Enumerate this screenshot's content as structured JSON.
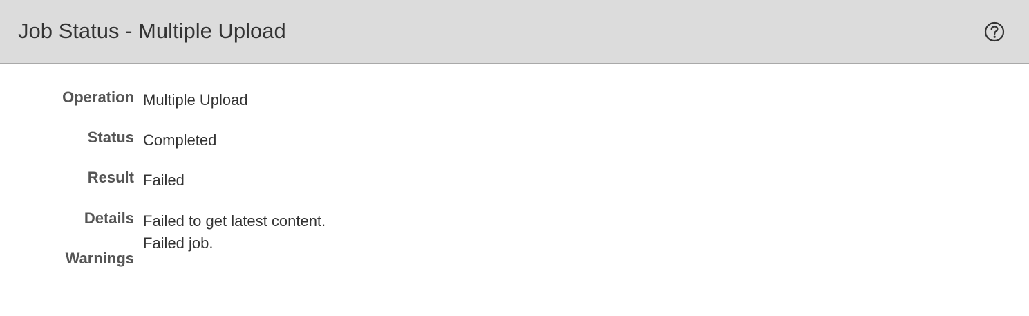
{
  "header": {
    "title": "Job Status - Multiple Upload",
    "help_icon": "help-circle-icon"
  },
  "fields": {
    "operation": {
      "label": "Operation",
      "value": "Multiple Upload"
    },
    "status": {
      "label": "Status",
      "value": "Completed"
    },
    "result": {
      "label": "Result",
      "value": "Failed"
    },
    "details": {
      "label": "Details",
      "lines": [
        "Failed to get latest content.",
        "Failed job."
      ]
    },
    "warnings": {
      "label": "Warnings",
      "value": ""
    }
  },
  "colors": {
    "header_bg": "#dcdcdc",
    "header_border": "#a9a9a9",
    "label_text": "#555555",
    "value_text": "#333333"
  }
}
